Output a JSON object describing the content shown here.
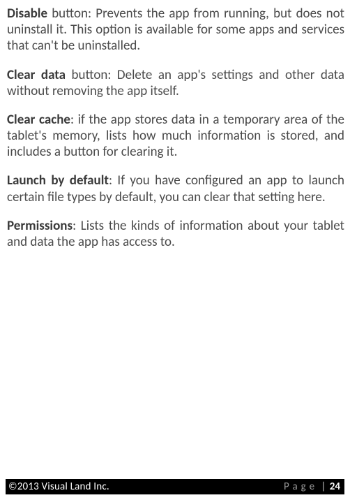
{
  "sections": {
    "disable": {
      "lead": "Disable",
      "rest": " button: Prevents the app from running, but does not uninstall it. This option is available for some apps and services that can't be uninstalled."
    },
    "clear_data": {
      "lead": "Clear data",
      "rest": " button: Delete an app's settings and other data without removing the app itself."
    },
    "clear_cache": {
      "lead": "Clear cache",
      "rest": ": if the app stores data in a temporary area of the tablet's memory, lists how much information is stored, and includes a button for clearing it."
    },
    "launch_default": {
      "lead": "Launch by default",
      "rest": ": If you have configured an app to launch certain file types by default, you can clear that setting here."
    },
    "permissions": {
      "lead": "Permissions",
      "rest": ": Lists the kinds of information about your tablet and data the app has access to."
    }
  },
  "footer": {
    "copyright": "©2013 Visual Land Inc.",
    "page_label": "Page",
    "separator": "|",
    "page_number": "24"
  }
}
